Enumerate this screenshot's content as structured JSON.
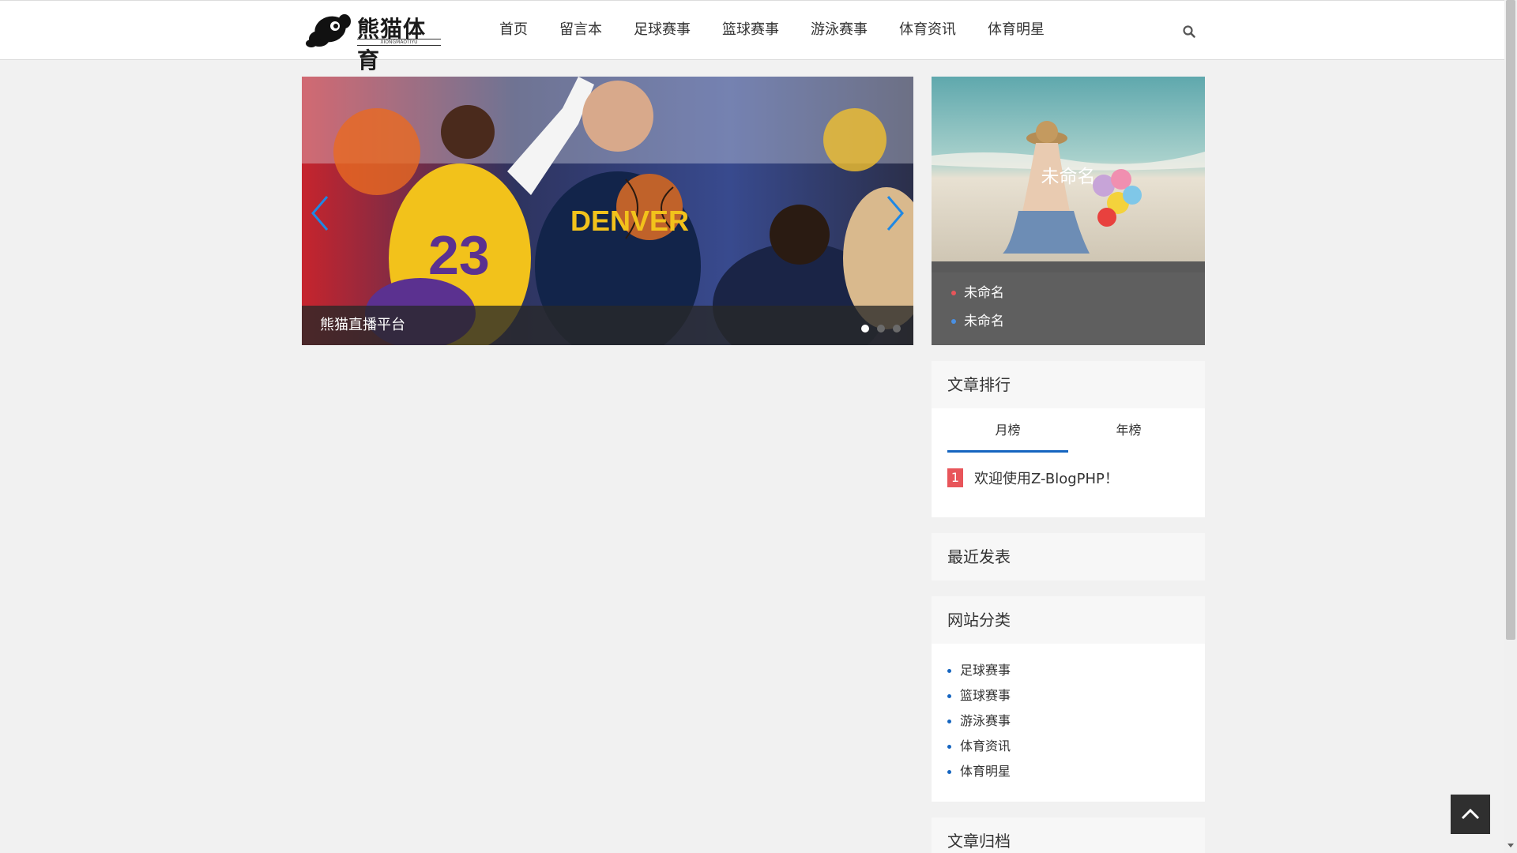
{
  "header": {
    "logo_text": "熊猫体育",
    "logo_sub": "XIONGMAOTIYU",
    "nav": [
      "首页",
      "留言本",
      "足球赛事",
      "篮球赛事",
      "游泳赛事",
      "体育资讯",
      "体育明星"
    ]
  },
  "slider": {
    "caption": "熊猫直播平台",
    "dots": 3,
    "active_dot": 0
  },
  "featured": {
    "title": "未命名",
    "items": [
      {
        "label": "未命名",
        "bullet_color": "#e8555a"
      },
      {
        "label": "未命名",
        "bullet_color": "#4a90e2"
      }
    ]
  },
  "rank": {
    "heading": "文章排行",
    "tabs": [
      "月榜",
      "年榜"
    ],
    "active_tab": 0,
    "items": [
      {
        "num": "1",
        "title": "欢迎使用Z-BlogPHP！"
      }
    ]
  },
  "recent": {
    "heading": "最近发表"
  },
  "categories": {
    "heading": "网站分类",
    "items": [
      "足球赛事",
      "篮球赛事",
      "游泳赛事",
      "体育资讯",
      "体育明星"
    ]
  },
  "archive": {
    "heading": "文章归档"
  },
  "colors": {
    "accent": "#1565c0",
    "rank_badge": "#e8555a"
  }
}
